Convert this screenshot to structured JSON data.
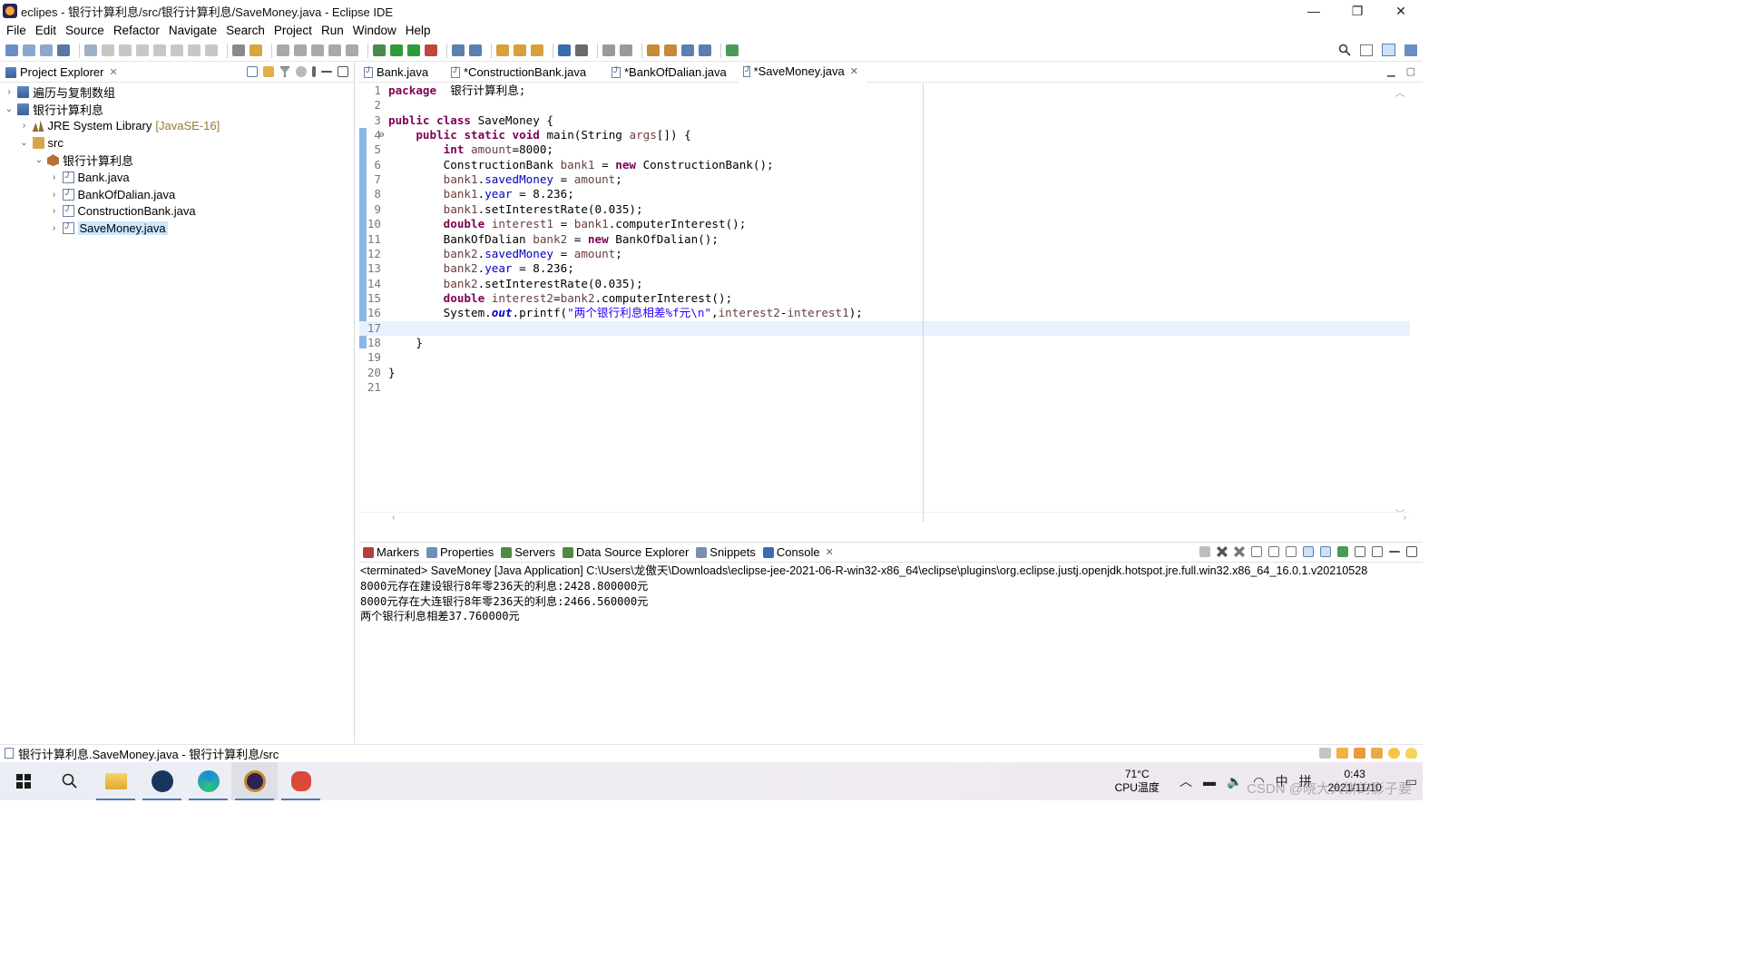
{
  "window": {
    "title": "eclipes - 银行计算利息/src/银行计算利息/SaveMoney.java - Eclipse IDE",
    "buttons": {
      "minimize": "—",
      "maximize": "❐",
      "close": "✕"
    }
  },
  "menu": [
    "File",
    "Edit",
    "Source",
    "Refactor",
    "Navigate",
    "Search",
    "Project",
    "Run",
    "Window",
    "Help"
  ],
  "explorer": {
    "title": "Project Explorer",
    "close": "✕",
    "tree": [
      {
        "label": "遍历与复制数组",
        "decor": "",
        "icon": "project-icon",
        "expanded": false,
        "indent": 0
      },
      {
        "label": "银行计算利息",
        "decor": "",
        "icon": "project-icon",
        "expanded": true,
        "indent": 0
      },
      {
        "label": "JRE System Library",
        "decor": "[JavaSE-16]",
        "icon": "library-icon",
        "expanded": false,
        "indent": 1
      },
      {
        "label": "src",
        "decor": "",
        "icon": "source-folder-icon",
        "expanded": true,
        "indent": 1
      },
      {
        "label": "银行计算利息",
        "decor": "",
        "icon": "package-icon",
        "expanded": true,
        "indent": 2
      },
      {
        "label": "Bank.java",
        "decor": "",
        "icon": "java-file-icon",
        "expanded": false,
        "indent": 3
      },
      {
        "label": "BankOfDalian.java",
        "decor": "",
        "icon": "java-file-icon",
        "expanded": false,
        "indent": 3
      },
      {
        "label": "ConstructionBank.java",
        "decor": "",
        "icon": "java-file-icon",
        "expanded": false,
        "indent": 3
      },
      {
        "label": "SaveMoney.java",
        "decor": "",
        "icon": "java-file-icon",
        "expanded": false,
        "indent": 3,
        "selected": true
      }
    ]
  },
  "editor": {
    "tabs": [
      {
        "label": "Bank.java",
        "active": false
      },
      {
        "label": "*ConstructionBank.java",
        "active": false
      },
      {
        "label": "*BankOfDalian.java",
        "active": false
      },
      {
        "label": "*SaveMoney.java",
        "active": true
      }
    ],
    "tab_close": "✕",
    "current_line": 17,
    "lines": [
      {
        "n": "1",
        "tokens": [
          [
            "kw",
            "package"
          ],
          [
            "",
            "  银行计算利息;"
          ]
        ]
      },
      {
        "n": "2",
        "tokens": []
      },
      {
        "n": "3",
        "tokens": [
          [
            "kw",
            "public"
          ],
          [
            "",
            " "
          ],
          [
            "kw",
            "class"
          ],
          [
            "",
            " SaveMoney {"
          ]
        ]
      },
      {
        "n": "4",
        "fold": "⊖",
        "tokens": [
          [
            "",
            "    "
          ],
          [
            "kw",
            "public"
          ],
          [
            "",
            " "
          ],
          [
            "kw",
            "static"
          ],
          [
            "",
            " "
          ],
          [
            "kw",
            "void"
          ],
          [
            "",
            " main(String "
          ],
          [
            "var",
            "args"
          ],
          [
            "",
            "[]) {"
          ]
        ]
      },
      {
        "n": "5",
        "tokens": [
          [
            "",
            "        "
          ],
          [
            "kw",
            "int"
          ],
          [
            "",
            " "
          ],
          [
            "var",
            "amount"
          ],
          [
            "",
            "=8000;"
          ]
        ]
      },
      {
        "n": "6",
        "tokens": [
          [
            "",
            "        ConstructionBank "
          ],
          [
            "var",
            "bank1"
          ],
          [
            "",
            " = "
          ],
          [
            "kw",
            "new"
          ],
          [
            "",
            " ConstructionBank();"
          ]
        ]
      },
      {
        "n": "7",
        "tokens": [
          [
            "",
            "        "
          ],
          [
            "var",
            "bank1"
          ],
          [
            "",
            "."
          ],
          [
            "fld",
            "savedMoney"
          ],
          [
            "",
            " = "
          ],
          [
            "var",
            "amount"
          ],
          [
            "",
            ";"
          ]
        ]
      },
      {
        "n": "8",
        "tokens": [
          [
            "",
            "        "
          ],
          [
            "var",
            "bank1"
          ],
          [
            "",
            "."
          ],
          [
            "fld",
            "year"
          ],
          [
            "",
            " = 8.236;"
          ]
        ]
      },
      {
        "n": "9",
        "tokens": [
          [
            "",
            "        "
          ],
          [
            "var",
            "bank1"
          ],
          [
            "",
            ".setInterestRate(0.035);"
          ]
        ]
      },
      {
        "n": "10",
        "tokens": [
          [
            "",
            "        "
          ],
          [
            "kw",
            "double"
          ],
          [
            "",
            " "
          ],
          [
            "var",
            "interest1"
          ],
          [
            "",
            " = "
          ],
          [
            "var",
            "bank1"
          ],
          [
            "",
            ".computerInterest();"
          ]
        ]
      },
      {
        "n": "11",
        "tokens": [
          [
            "",
            "        BankOfDalian "
          ],
          [
            "var",
            "bank2"
          ],
          [
            "",
            " = "
          ],
          [
            "kw",
            "new"
          ],
          [
            "",
            " BankOfDalian();"
          ]
        ]
      },
      {
        "n": "12",
        "tokens": [
          [
            "",
            "        "
          ],
          [
            "var",
            "bank2"
          ],
          [
            "",
            "."
          ],
          [
            "fld",
            "savedMoney"
          ],
          [
            "",
            " = "
          ],
          [
            "var",
            "amount"
          ],
          [
            "",
            ";"
          ]
        ]
      },
      {
        "n": "13",
        "tokens": [
          [
            "",
            "        "
          ],
          [
            "var",
            "bank2"
          ],
          [
            "",
            "."
          ],
          [
            "fld",
            "year"
          ],
          [
            "",
            " = 8.236;"
          ]
        ]
      },
      {
        "n": "14",
        "tokens": [
          [
            "",
            "        "
          ],
          [
            "var",
            "bank2"
          ],
          [
            "",
            ".setInterestRate(0.035);"
          ]
        ]
      },
      {
        "n": "15",
        "tokens": [
          [
            "",
            "        "
          ],
          [
            "kw",
            "double"
          ],
          [
            "",
            " "
          ],
          [
            "var",
            "interest2"
          ],
          [
            "",
            "="
          ],
          [
            "var",
            "bank2"
          ],
          [
            "",
            ".computerInterest();"
          ]
        ]
      },
      {
        "n": "16",
        "tokens": [
          [
            "",
            "        System."
          ],
          [
            "sfld",
            "out"
          ],
          [
            "",
            ".printf("
          ],
          [
            "str",
            "\"两个银行利息相差%f元\\n\""
          ],
          [
            "",
            ","
          ],
          [
            "var",
            "interest2"
          ],
          [
            "",
            "-"
          ],
          [
            "var",
            "interest1"
          ],
          [
            "",
            ");"
          ]
        ]
      },
      {
        "n": "17",
        "tokens": []
      },
      {
        "n": "18",
        "tokens": [
          [
            "",
            "    }"
          ]
        ]
      },
      {
        "n": "19",
        "tokens": []
      },
      {
        "n": "20",
        "tokens": [
          [
            "",
            "}"
          ]
        ]
      },
      {
        "n": "21",
        "tokens": []
      }
    ]
  },
  "bottom_panel": {
    "tabs": [
      {
        "label": "Markers",
        "icon": "markers-icon",
        "color": "#b0413e"
      },
      {
        "label": "Properties",
        "icon": "properties-icon",
        "color": "#6d8fb8"
      },
      {
        "label": "Servers",
        "icon": "servers-icon",
        "color": "#4f8a45"
      },
      {
        "label": "Data Source Explorer",
        "icon": "data-source-icon",
        "color": "#4f8a45"
      },
      {
        "label": "Snippets",
        "icon": "snippets-icon",
        "color": "#7c8fb1"
      },
      {
        "label": "Console",
        "icon": "console-icon",
        "color": "#3b6db3",
        "active": true
      }
    ],
    "console_header": "<terminated> SaveMoney [Java Application] C:\\Users\\龙傲天\\Downloads\\eclipse-jee-2021-06-R-win32-x86_64\\eclipse\\plugins\\org.eclipse.justj.openjdk.hotspot.jre.full.win32.x86_64_16.0.1.v20210528",
    "output": [
      "8000元存在建设银行8年零236天的利息:2428.800000元",
      "8000元存在大连银行8年零236天的利息:2466.560000元",
      "两个银行利息相差37.760000元"
    ]
  },
  "status": {
    "text": "银行计算利息.SaveMoney.java - 银行计算利息/src"
  },
  "taskbar": {
    "temperature": "71°C",
    "temperature_label": "CPU温度",
    "time": "0:43",
    "date": "2021/11/10",
    "ime": "中",
    "ime2": "拼",
    "watermark": "CSDN @晓大大饼的影子要"
  },
  "colors": {
    "keyword": "#7f0055",
    "field": "#0000c0",
    "string": "#2a00ff",
    "selection": "#cce8ff",
    "current_line": "#e8f2fe"
  }
}
